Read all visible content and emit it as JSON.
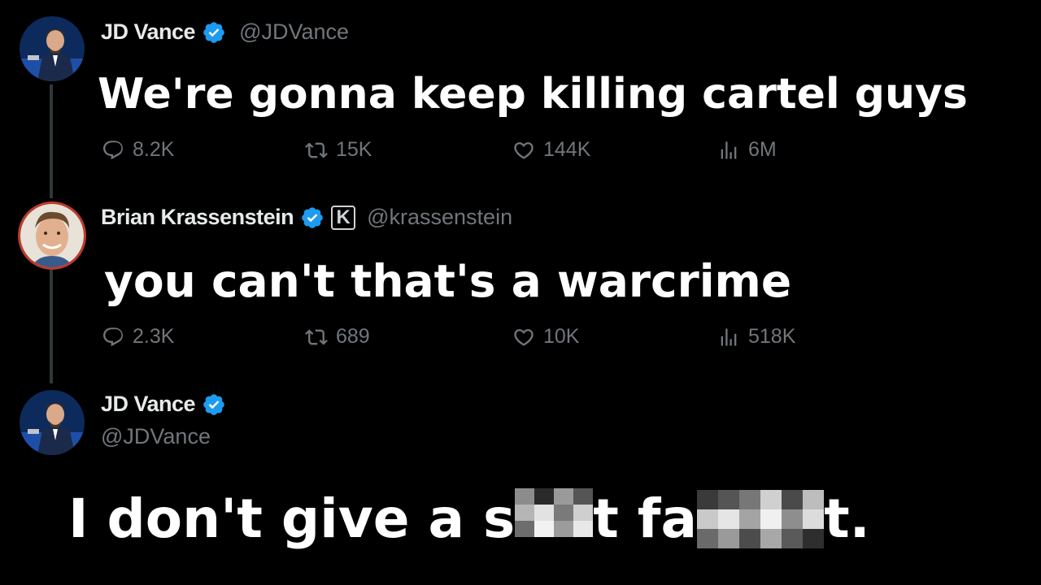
{
  "tweets": [
    {
      "name": "JD Vance",
      "handle": "@JDVance",
      "text": "We're gonna keep killing cartel guys",
      "metrics": {
        "replies": "8.2K",
        "retweets": "15K",
        "likes": "144K",
        "views": "6M"
      }
    },
    {
      "name": "Brian Krassenstein",
      "handle": "@krassenstein",
      "affiliate_badge": "K",
      "text": "you can't that's a warcrime",
      "metrics": {
        "replies": "2.3K",
        "retweets": "689",
        "likes": "10K",
        "views": "518K"
      }
    },
    {
      "name": "JD Vance",
      "handle": "@JDVance",
      "text_parts": [
        "I don't give a s",
        "t fa",
        "t."
      ]
    }
  ],
  "colors": {
    "background": "#000000",
    "verified": "#1d9bf0",
    "secondary_text": "#71767b",
    "thread_line": "#333639"
  },
  "icons": [
    "reply-icon",
    "retweet-icon",
    "like-icon",
    "views-icon",
    "verified-icon"
  ]
}
